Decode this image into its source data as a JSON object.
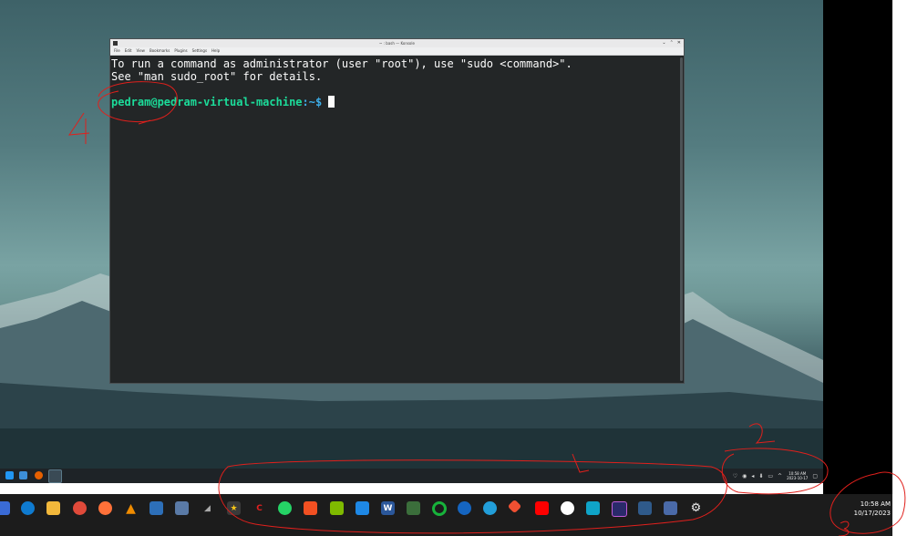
{
  "konsole": {
    "title": "~ : bash — Konsole",
    "menu": [
      "File",
      "Edit",
      "View",
      "Bookmarks",
      "Plugins",
      "Settings",
      "Help"
    ],
    "window_controls": [
      "⌄",
      "⌃",
      "✕"
    ],
    "line1": "To run a command as administrator (user \"root\"), use \"sudo <command>\".",
    "line2": "See \"man sudo_root\" for details.",
    "prompt_user": "pedram@pedram-virtual-machine",
    "prompt_path": ":~$",
    "prompt_sep": " "
  },
  "vm_taskbar": {
    "time": "10:58 AM",
    "date": "2023-10-17"
  },
  "host_taskbar": {
    "time": "10:58 AM",
    "date": "10/17/2023"
  },
  "annotations": {
    "label_4": "4",
    "label_1": "1",
    "label_2": "2",
    "label_3": "3"
  },
  "colors": {
    "terminal_bg": "#232627",
    "prompt_green": "#1cdc9a",
    "annotation_red": "#e0201c"
  }
}
